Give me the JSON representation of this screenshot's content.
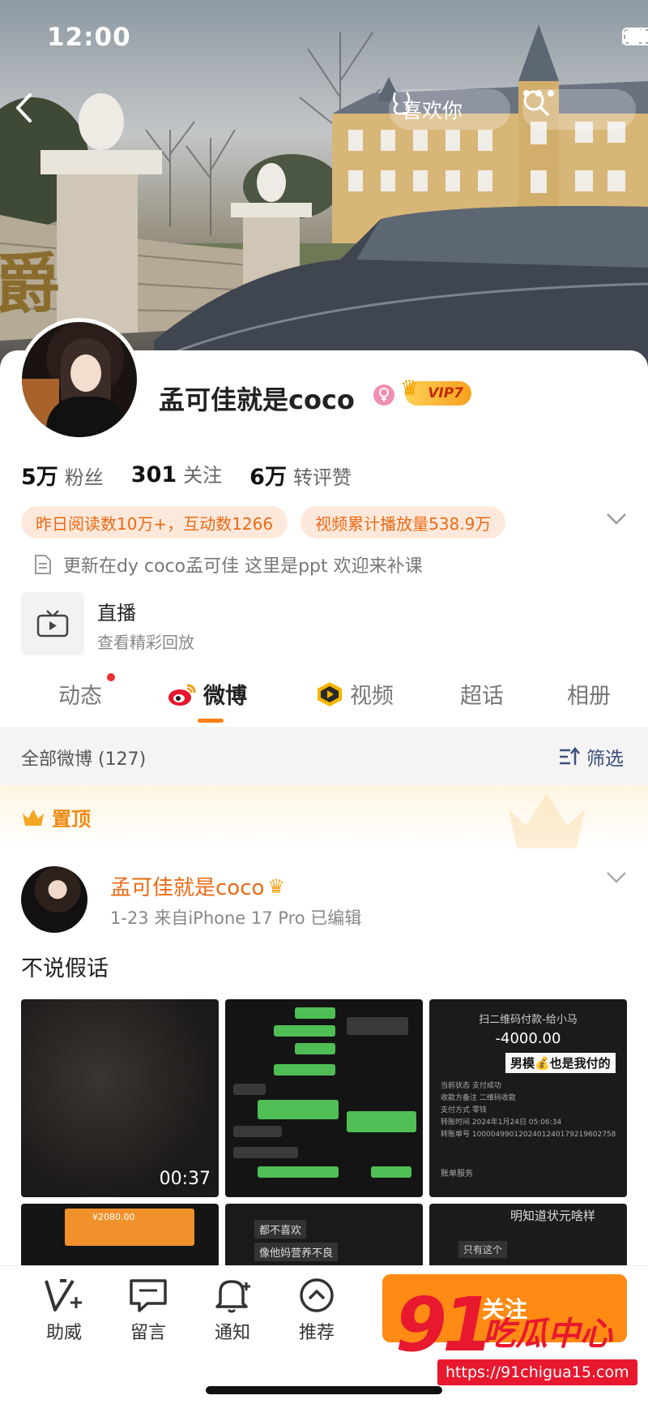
{
  "status_bar": {
    "time": "12:00"
  },
  "header": {
    "like_label": "喜欢你"
  },
  "profile": {
    "name": "孟可佳就是coco",
    "vip_label": "VIP7",
    "stats": [
      {
        "value": "5万",
        "label": "粉丝"
      },
      {
        "value": "301",
        "label": "关注"
      },
      {
        "value": "6万",
        "label": "转评赞"
      }
    ],
    "pills": [
      "昨日阅读数10万+，互动数1266",
      "视频累计播放量538.9万"
    ],
    "bio": "更新在dy coco孟可佳 这里是ppt 欢迎来补课",
    "live": {
      "title": "直播",
      "subtitle": "查看精彩回放"
    }
  },
  "tabs": [
    {
      "label": "动态",
      "icon": ""
    },
    {
      "label": "微博",
      "icon": "weibo-icon",
      "active": true
    },
    {
      "label": "视频",
      "icon": "video-icon"
    },
    {
      "label": "超话",
      "icon": ""
    },
    {
      "label": "相册",
      "icon": ""
    }
  ],
  "filter": {
    "left": "全部微博 (127)",
    "right": "筛选"
  },
  "pinned": {
    "label": "置顶"
  },
  "post": {
    "author": "孟可佳就是coco",
    "meta": "1-23  来自iPhone 17 Pro  已编辑",
    "text": "不说假话",
    "video_duration": "00:37",
    "payment": {
      "title": "扫二维码付款-给小马",
      "amount": "-4000.00",
      "note": "男模💰也是我付的",
      "rows": [
        "当前状态    支付成功",
        "收款方备注    二维码收款",
        "支付方式    零钱",
        "转账时间    2024年1月24日 05:06:34",
        "转账单号    1000049901202401240179219602758"
      ],
      "footer": "账单服务"
    },
    "thumb4_amount": "¥2080.00",
    "thumb5_text": [
      "都不喜欢",
      "像他妈营养不良"
    ],
    "thumb6_text": [
      "明知道状元啥样",
      "只有这个"
    ]
  },
  "bottom_nav": [
    {
      "label": "助威",
      "icon": "cheer-icon"
    },
    {
      "label": "留言",
      "icon": "message-icon"
    },
    {
      "label": "通知",
      "icon": "bell-icon"
    },
    {
      "label": "推荐",
      "icon": "recommend-icon"
    }
  ],
  "follow_label": "关注",
  "watermark": {
    "brand": "91",
    "name": "吃瓜中心",
    "url": "https://91chigua15.com"
  },
  "colors": {
    "accent": "#ff8a14",
    "link": "#ec6a14",
    "live_dot": "#ee2e2e"
  }
}
